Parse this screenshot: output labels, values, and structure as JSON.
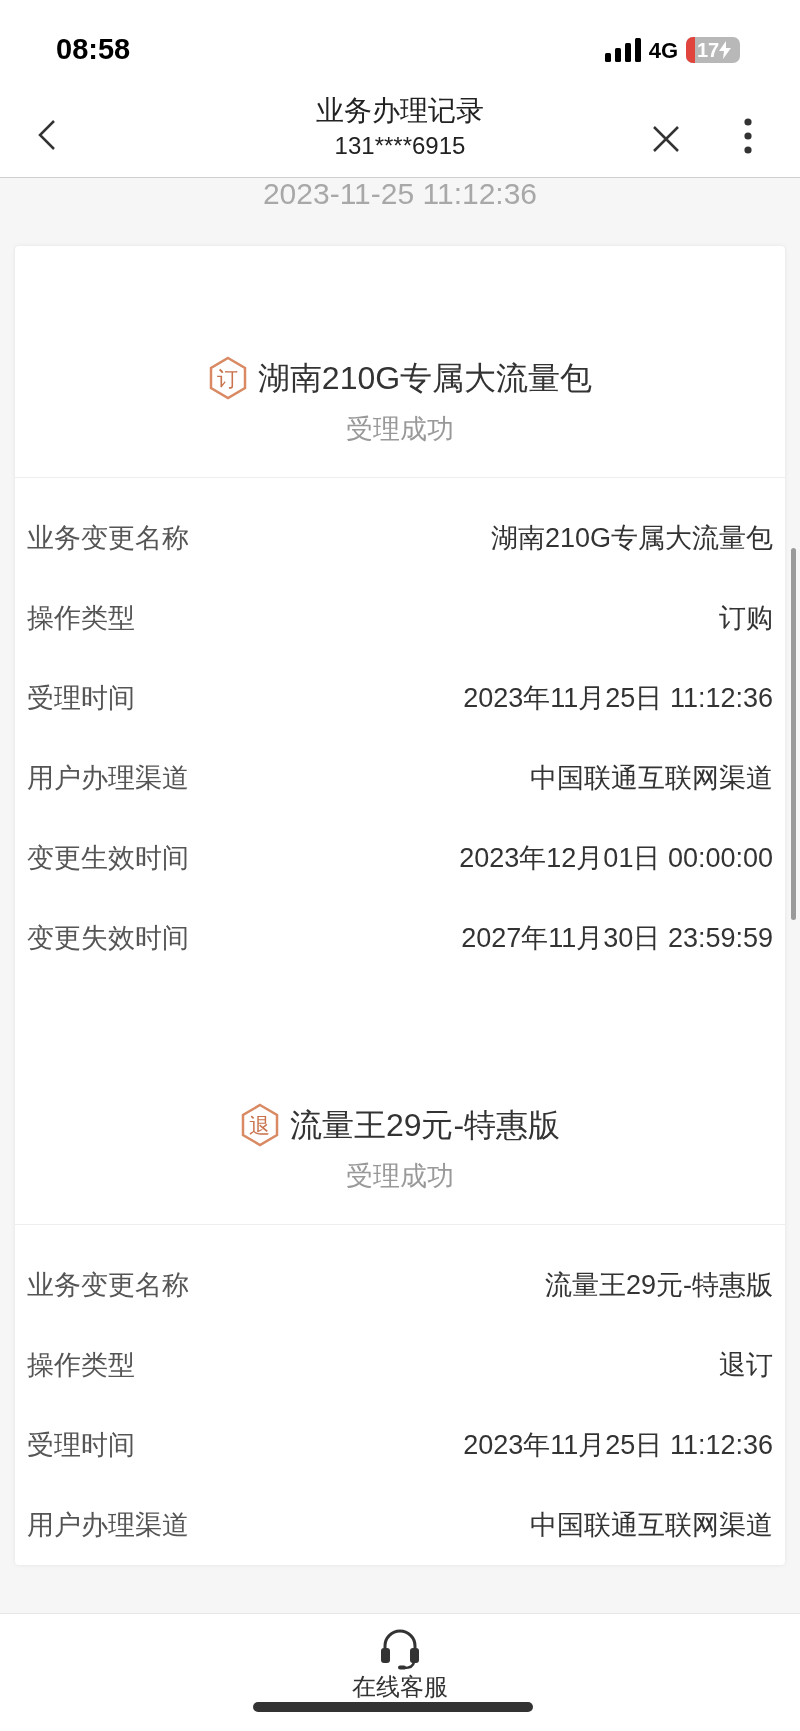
{
  "status_bar": {
    "time": "08:58",
    "network": "4G",
    "battery": "17"
  },
  "nav": {
    "title": "业务办理记录",
    "subtitle": "131****6915"
  },
  "date": "2023-11-25 11:12:36",
  "records": [
    {
      "badge": "订",
      "title": "湖南210G专属大流量包",
      "status": "受理成功",
      "rows": [
        {
          "label": "业务变更名称",
          "value": "湖南210G专属大流量包"
        },
        {
          "label": "操作类型",
          "value": "订购"
        },
        {
          "label": "受理时间",
          "value": "2023年11月25日 11:12:36"
        },
        {
          "label": "用户办理渠道",
          "value": "中国联通互联网渠道"
        },
        {
          "label": "变更生效时间",
          "value": "2023年12月01日 00:00:00"
        },
        {
          "label": "变更失效时间",
          "value": "2027年11月30日 23:59:59"
        }
      ]
    },
    {
      "badge": "退",
      "title": "流量王29元-特惠版",
      "status": "受理成功",
      "rows": [
        {
          "label": "业务变更名称",
          "value": "流量王29元-特惠版"
        },
        {
          "label": "操作类型",
          "value": "退订"
        },
        {
          "label": "受理时间",
          "value": "2023年11月25日 11:12:36"
        },
        {
          "label": "用户办理渠道",
          "value": "中国联通互联网渠道"
        }
      ]
    }
  ],
  "bottom_bar": {
    "label": "在线客服"
  }
}
